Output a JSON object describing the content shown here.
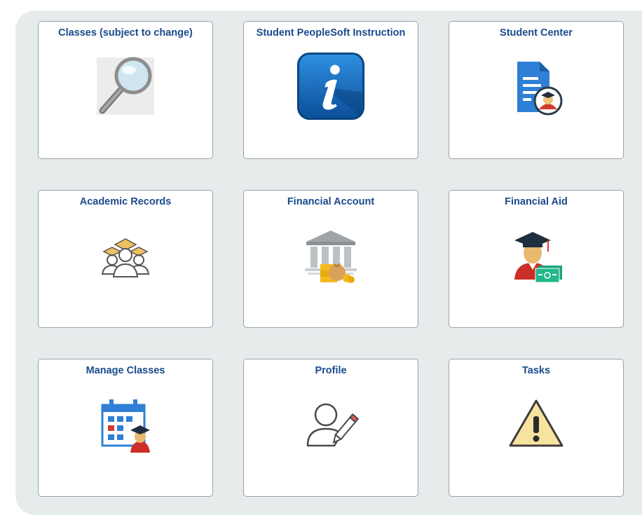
{
  "tiles": [
    {
      "title": "Classes (subject to change)",
      "icon": "magnifying-glass-icon"
    },
    {
      "title": "Student PeopleSoft Instruction",
      "icon": "info-icon"
    },
    {
      "title": "Student Center",
      "icon": "student-document-icon"
    },
    {
      "title": "Academic Records",
      "icon": "graduates-group-icon"
    },
    {
      "title": "Financial Account",
      "icon": "bank-money-icon"
    },
    {
      "title": "Financial Aid",
      "icon": "graduate-with-money-icon"
    },
    {
      "title": "Manage Classes",
      "icon": "calendar-graduate-icon"
    },
    {
      "title": "Profile",
      "icon": "user-edit-icon"
    },
    {
      "title": "Tasks",
      "icon": "warning-icon"
    }
  ],
  "colors": {
    "title_text": "#1a4b8c",
    "page_background": "#e6ecec",
    "tile_border": "#9aa3ad"
  }
}
